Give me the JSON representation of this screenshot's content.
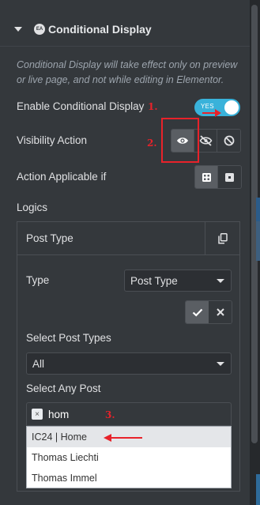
{
  "section": {
    "title": "Conditional Display",
    "badge": "EA"
  },
  "note": "Conditional Display will take effect only on preview or live page, and not while editing in Elementor.",
  "enable": {
    "label": "Enable Conditional Display",
    "toggle_text": "YES",
    "on": true
  },
  "visibility": {
    "label": "Visibility Action",
    "options": [
      "show-eye-icon",
      "hide-eye-slash-icon",
      "disable-ban-icon"
    ],
    "active": 0
  },
  "applicable": {
    "label": "Action Applicable if",
    "options": [
      "all-grid-icon",
      "any-square-icon"
    ],
    "active": 0
  },
  "logics": {
    "label": "Logics",
    "item_title": "Post Type",
    "type_label": "Type",
    "type_value": "Post Type",
    "select_post_types_label": "Select Post Types",
    "select_post_types_value": "All",
    "select_any_post_label": "Select Any Post",
    "search_text": "hom",
    "chip_remove": "×",
    "results": [
      "IC24 | Home",
      "Thomas Liechti",
      "Thomas Immel"
    ],
    "highlighted_index": 0
  },
  "annotations": {
    "one": "1.",
    "two": "2.",
    "three": "3."
  },
  "colors": {
    "accent": "#39b2da",
    "annotation": "#e8222a",
    "panel": "#34383c"
  }
}
